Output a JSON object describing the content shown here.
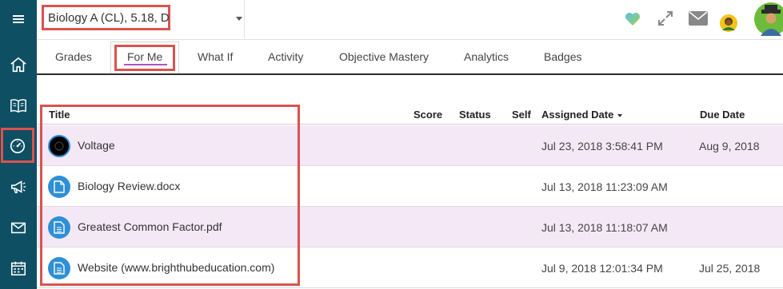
{
  "colors": {
    "sidebar_bg": "#0e4f63",
    "highlight_box": "#d9534f",
    "active_tab_underline": "#b052c4",
    "row_alt_bg": "#f4e8f6",
    "file_icon_bg": "#2f8fd6",
    "heart_icon": "#8fd16a"
  },
  "sidebar": {
    "items": [
      {
        "name": "menu",
        "icon": "hamburger-icon"
      },
      {
        "name": "home",
        "icon": "home-icon"
      },
      {
        "name": "courses",
        "icon": "book-icon"
      },
      {
        "name": "grades",
        "icon": "gauge-icon",
        "selected": true
      },
      {
        "name": "announcements",
        "icon": "megaphone-icon"
      },
      {
        "name": "messages",
        "icon": "mail-icon"
      },
      {
        "name": "calendar",
        "icon": "calendar-icon"
      }
    ]
  },
  "header": {
    "course_select_value": "Biology A (CL), 5.18, D",
    "icons": [
      "heart-icon",
      "expand-icon",
      "mail-icon",
      "student-avatar",
      "user-avatar"
    ]
  },
  "tabs": [
    {
      "label": "Grades"
    },
    {
      "label": "For Me",
      "active": true
    },
    {
      "label": "What If"
    },
    {
      "label": "Activity"
    },
    {
      "label": "Objective Mastery"
    },
    {
      "label": "Analytics"
    },
    {
      "label": "Badges"
    }
  ],
  "table": {
    "columns": {
      "title": "Title",
      "score": "Score",
      "status": "Status",
      "self": "Self",
      "assigned": "Assigned Date",
      "due": "Due Date"
    },
    "rows": [
      {
        "title": "Voltage",
        "icon": "video-icon",
        "assigned": "Jul 23, 2018 3:58:41 PM",
        "due": "Aug 9, 2018"
      },
      {
        "title": "Biology Review.docx",
        "icon": "document-icon",
        "assigned": "Jul 13, 2018 11:23:09 AM",
        "due": ""
      },
      {
        "title": "Greatest Common Factor.pdf",
        "icon": "document-lines-icon",
        "assigned": "Jul 13, 2018 11:18:07 AM",
        "due": ""
      },
      {
        "title": "Website (www.brighthubeducation.com)",
        "icon": "document-lines-icon",
        "assigned": "Jul 9, 2018 12:01:34 PM",
        "due": "Jul 25, 2018"
      }
    ]
  }
}
